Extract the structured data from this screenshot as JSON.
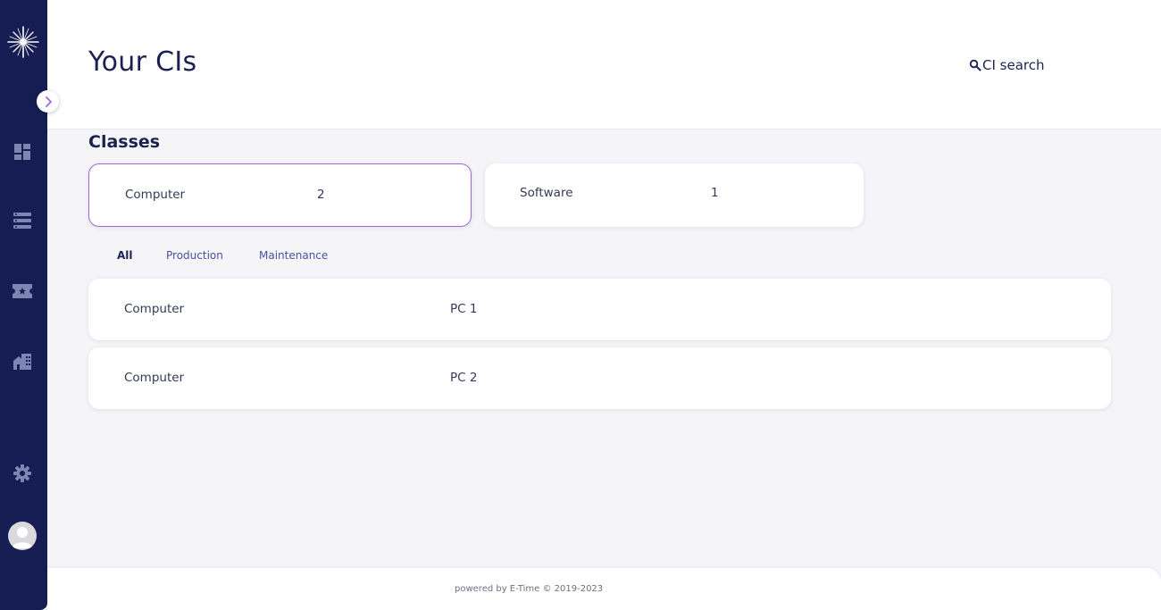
{
  "header": {
    "title": "Your CIs",
    "search_label": "CI search"
  },
  "sidebar": {
    "logo": "star-logo-icon",
    "collapse_icon": "chevron-right-icon",
    "items": [
      {
        "icon": "dashboard-icon"
      },
      {
        "icon": "list-icon"
      },
      {
        "icon": "ticket-icon"
      },
      {
        "icon": "buildings-icon"
      }
    ],
    "settings_icon": "gear-icon",
    "avatar_icon": "user-avatar-icon"
  },
  "classes": {
    "title": "Classes",
    "items": [
      {
        "name": "Computer",
        "count": "2",
        "selected": true
      },
      {
        "name": "Software",
        "count": "1",
        "selected": false
      }
    ]
  },
  "tabs": [
    {
      "label": "All",
      "active": true
    },
    {
      "label": "Production",
      "active": false
    },
    {
      "label": "Maintenance",
      "active": false
    }
  ],
  "ci_list": [
    {
      "class": "Computer",
      "name": "PC 1"
    },
    {
      "class": "Computer",
      "name": "PC 2"
    }
  ],
  "footer": {
    "text": "powered by E-Time © 2019-2023"
  },
  "colors": {
    "sidebar_bg": "#161d52",
    "accent": "#9a6ad8",
    "text_primary": "#1c2150",
    "tab_link": "#4a4fa6",
    "background": "#f5f5f8"
  }
}
